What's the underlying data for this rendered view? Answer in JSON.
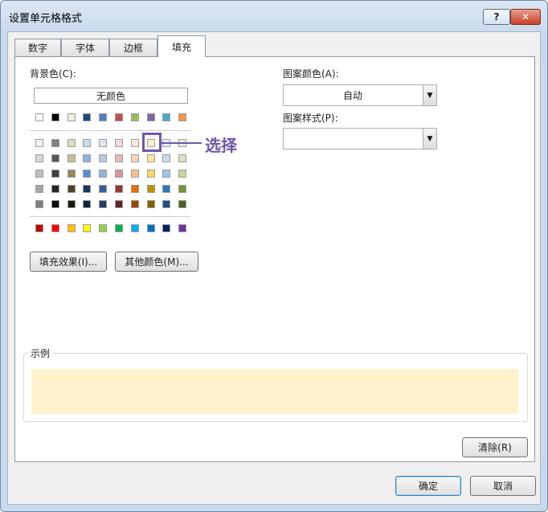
{
  "window": {
    "title": "设置单元格格式",
    "help_label": "?",
    "close_label": "✕"
  },
  "tabs": [
    {
      "label": "数字",
      "active": false
    },
    {
      "label": "字体",
      "active": false
    },
    {
      "label": "边框",
      "active": false
    },
    {
      "label": "填充",
      "active": true
    }
  ],
  "fill": {
    "background_label": "背景色(C):",
    "no_color_label": "无颜色",
    "theme_top": [
      "#ffffff",
      "#000000",
      "#eeece1",
      "#1f497d",
      "#4f81bd",
      "#c0504d",
      "#9bbb59",
      "#8064a2",
      "#4bacc6",
      "#f79646"
    ],
    "theme_shades": [
      [
        "#f2f2f2",
        "#7f7f7f",
        "#ddd9c3",
        "#c6d9f0",
        "#dbe5f1",
        "#f2dcdb",
        "#fde9d9",
        "#fff2cc",
        "#e5f1fb",
        "#ebf1dd"
      ],
      [
        "#d8d8d8",
        "#595959",
        "#c4bd97",
        "#8db3e2",
        "#b8cce4",
        "#e5b9b7",
        "#fbd5b5",
        "#ffe699",
        "#c6dbef",
        "#d7e3bc"
      ],
      [
        "#bfbfbf",
        "#3f3f3f",
        "#938953",
        "#548dd4",
        "#95b3d7",
        "#d99694",
        "#fac08f",
        "#ffd966",
        "#9dc3e6",
        "#c3d69b"
      ],
      [
        "#a5a5a5",
        "#262626",
        "#494429",
        "#17365d",
        "#366092",
        "#953734",
        "#e36c09",
        "#bf9000",
        "#2e75b6",
        "#76923c"
      ],
      [
        "#7f7f7f",
        "#0c0c0c",
        "#1d1b10",
        "#0f243e",
        "#244061",
        "#632423",
        "#974806",
        "#7f6000",
        "#1f4e79",
        "#4f6128"
      ]
    ],
    "standard_colors": [
      "#c00000",
      "#ff0000",
      "#ffc000",
      "#ffff00",
      "#92d050",
      "#00b050",
      "#00b0f0",
      "#0070c0",
      "#002060",
      "#7030a0"
    ],
    "selected_color": "#fff2cc",
    "selection_annotation": "选择",
    "fill_effects_label": "填充效果(I)...",
    "more_colors_label": "其他颜色(M)...",
    "pattern_color_label": "图案颜色(A):",
    "pattern_color_value": "自动",
    "pattern_style_label": "图案样式(P):",
    "pattern_style_value": ""
  },
  "sample": {
    "label": "示例",
    "fill_color": "#fff2cc"
  },
  "buttons": {
    "clear_label": "清除(R)",
    "ok_label": "确定",
    "cancel_label": "取消"
  }
}
